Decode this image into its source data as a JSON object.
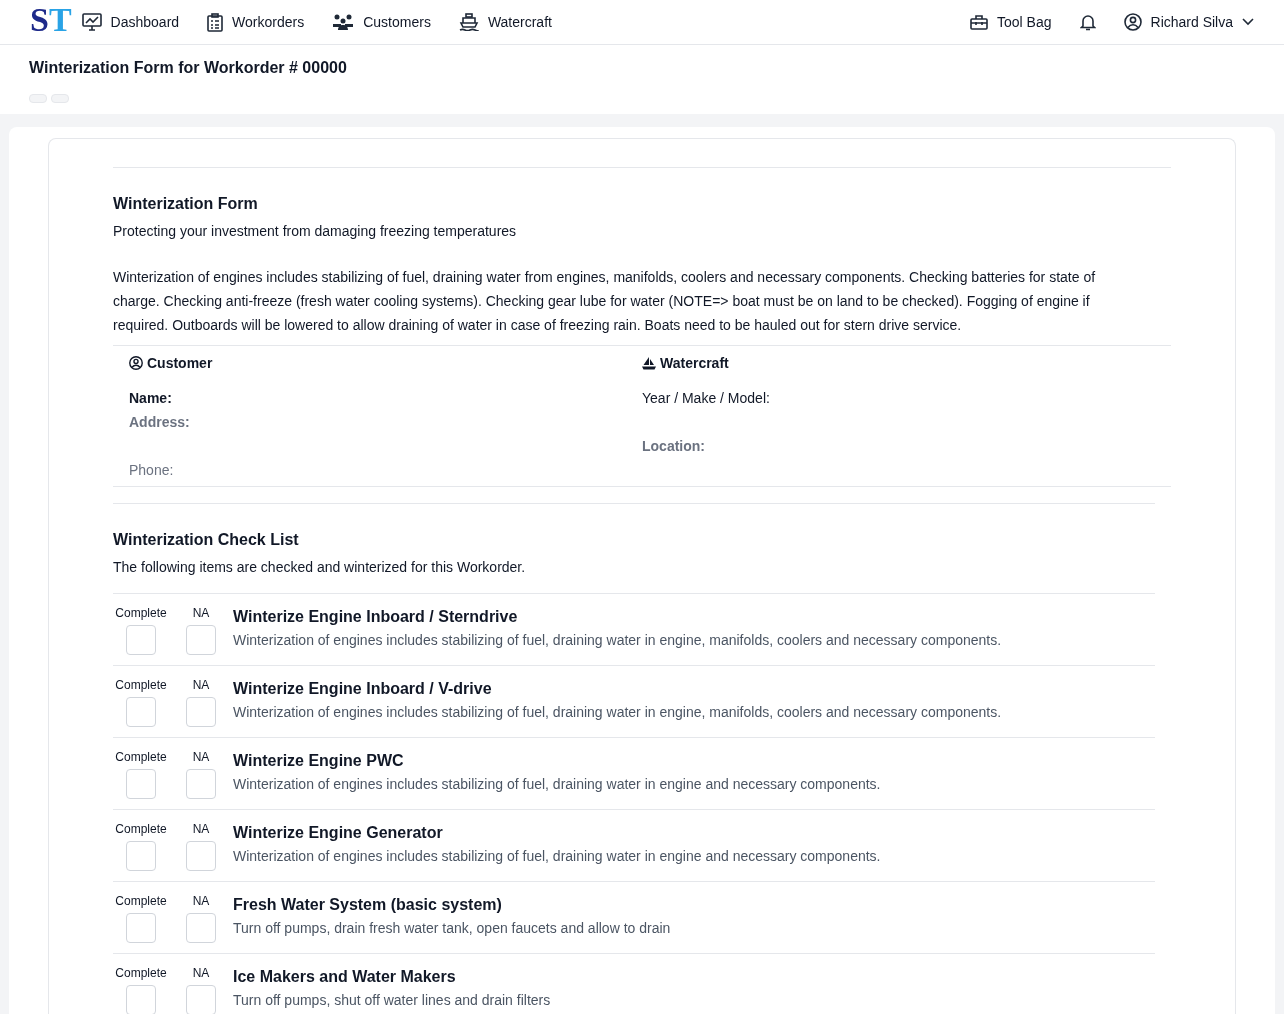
{
  "nav": {
    "logo": "ST",
    "items": [
      {
        "kind": "dashboard",
        "label": "Dashboard"
      },
      {
        "kind": "workorders",
        "label": "Workorders"
      },
      {
        "kind": "customers",
        "label": "Customers"
      },
      {
        "kind": "watercraft",
        "label": "Watercraft"
      }
    ],
    "tool_bag": "Tool Bag",
    "user": "Richard Silva"
  },
  "page_title": "Winterization Form for Workorder # 00000",
  "form": {
    "title": "Winterization Form",
    "subtitle": "Protecting your investment from damaging freezing temperatures",
    "description": "Winterization of engines includes stabilizing of fuel, draining water from engines, manifolds, coolers and necessary components. Checking batteries for state of charge. Checking anti-freeze (fresh water cooling systems). Checking gear lube for water (NOTE=> boat must be on land to be checked). Fogging of engine if required. Outboards will be lowered to allow draining of water in case of freezing rain. Boats need to be hauled out for stern drive service."
  },
  "customer": {
    "heading": "Customer",
    "name_label": "Name:",
    "address_label": "Address:",
    "phone_label": "Phone:"
  },
  "watercraft": {
    "heading": "Watercraft",
    "ymm_label": "Year / Make / Model:",
    "location_label": "Location:"
  },
  "checklist": {
    "title": "Winterization Check List",
    "subtitle": "The following items are checked and winterized for this Workorder.",
    "items": [
      {
        "complete_label": "Complete",
        "na_label": "NA",
        "title": "Winterize Engine Inboard / Sterndrive",
        "description": "Winterization of engines includes stabilizing of fuel, draining water in engine, manifolds, coolers and necessary components.",
        "complete": false,
        "na": false
      },
      {
        "complete_label": "Complete",
        "na_label": "NA",
        "title": "Winterize Engine Inboard / V-drive",
        "description": "Winterization of engines includes stabilizing of fuel, draining water in engine, manifolds, coolers and necessary components.",
        "complete": false,
        "na": false
      },
      {
        "complete_label": "Complete",
        "na_label": "NA",
        "title": "Winterize Engine PWC",
        "description": "Winterization of engines includes stabilizing of fuel, draining water in engine and necessary components.",
        "complete": false,
        "na": false
      },
      {
        "complete_label": "Complete",
        "na_label": "NA",
        "title": "Winterize Engine Generator",
        "description": "Winterization of engines includes stabilizing of fuel, draining water in engine and necessary components.",
        "complete": false,
        "na": false
      },
      {
        "complete_label": "Complete",
        "na_label": "NA",
        "title": "Fresh Water System (basic system)",
        "description": "Turn off pumps, drain fresh water tank, open faucets and allow to drain",
        "complete": false,
        "na": false
      },
      {
        "complete_label": "Complete",
        "na_label": "NA",
        "title": "Ice Makers and Water Makers",
        "description": "Turn off pumps, shut off water lines and drain filters",
        "complete": false,
        "na": false
      }
    ]
  }
}
